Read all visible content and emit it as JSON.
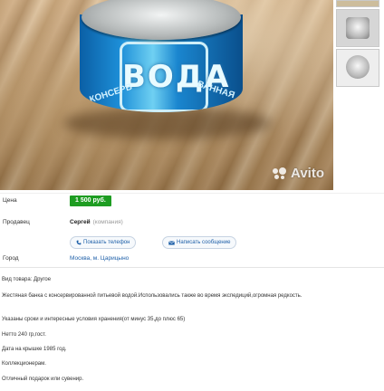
{
  "photo": {
    "can_label": "ВОДА",
    "can_ring_left": "КОНСЕРВ",
    "can_ring_right": "ВАННАЯ",
    "watermark": "Avito",
    "thumbnails": [
      "thumb-1",
      "thumb-2",
      "thumb-3"
    ]
  },
  "details": {
    "price_label": "Цена",
    "price_value": "1 500 руб.",
    "seller_label": "Продавец",
    "seller_name": "Сергей",
    "seller_role": "(компания)",
    "show_phone": "Показать телефон",
    "send_message": "Написать сообщение",
    "city_label": "Город",
    "city_value": "Москва, м. Царицыно"
  },
  "description": {
    "type": "Вид товара: Другое",
    "line1": "Жестяная банка с консервированной питьевой водой.Использовались также во время экспедиций,огромная редкость.",
    "line2": "Указаны сроки и интересные условия хранения(от минус 35,до плюс 65)",
    "line3": "Нетто 240 гр,гост.",
    "line4": "Дата на крышке 1985 год.",
    "line5": "Коллекционерам.",
    "line6": "Отличный подарок или сувенир."
  },
  "colors": {
    "price_badge": "#1e9d22",
    "link": "#1d5fa8"
  }
}
